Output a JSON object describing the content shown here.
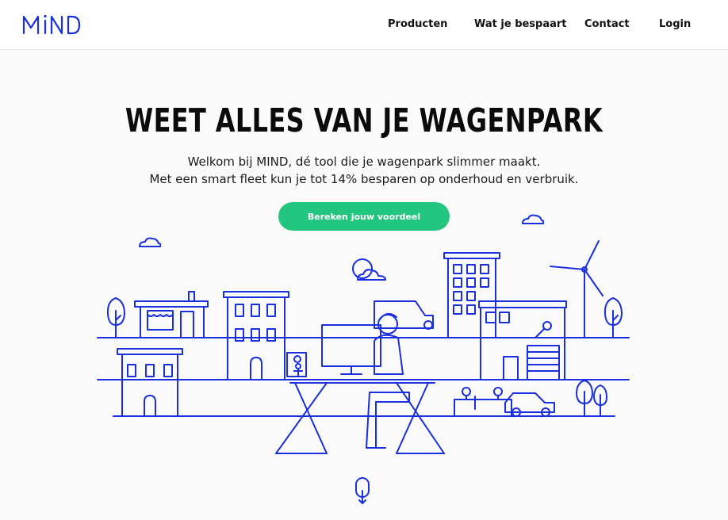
{
  "header": {
    "logo_text": "MIND",
    "nav": [
      {
        "label": "Producten"
      },
      {
        "label": "Wat je bespaart"
      },
      {
        "label": "Contact"
      },
      {
        "label": "Login"
      }
    ]
  },
  "hero": {
    "title": "WEET ALLES VAN JE WAGENPARK",
    "line1": "Welkom bij MIND, dé tool die je wagenpark slimmer maakt.",
    "line2": "Met een smart fleet kun je tot 14% besparen op onderhoud en verbruik.",
    "cta_label": "Bereken jouw voordeel"
  },
  "colors": {
    "brand_blue": "#1a2fe0",
    "cta_green": "#23c67f",
    "background": "#fafafa"
  },
  "icons": {
    "logo": "mind-logo",
    "scroll": "mouse-scroll-icon"
  }
}
